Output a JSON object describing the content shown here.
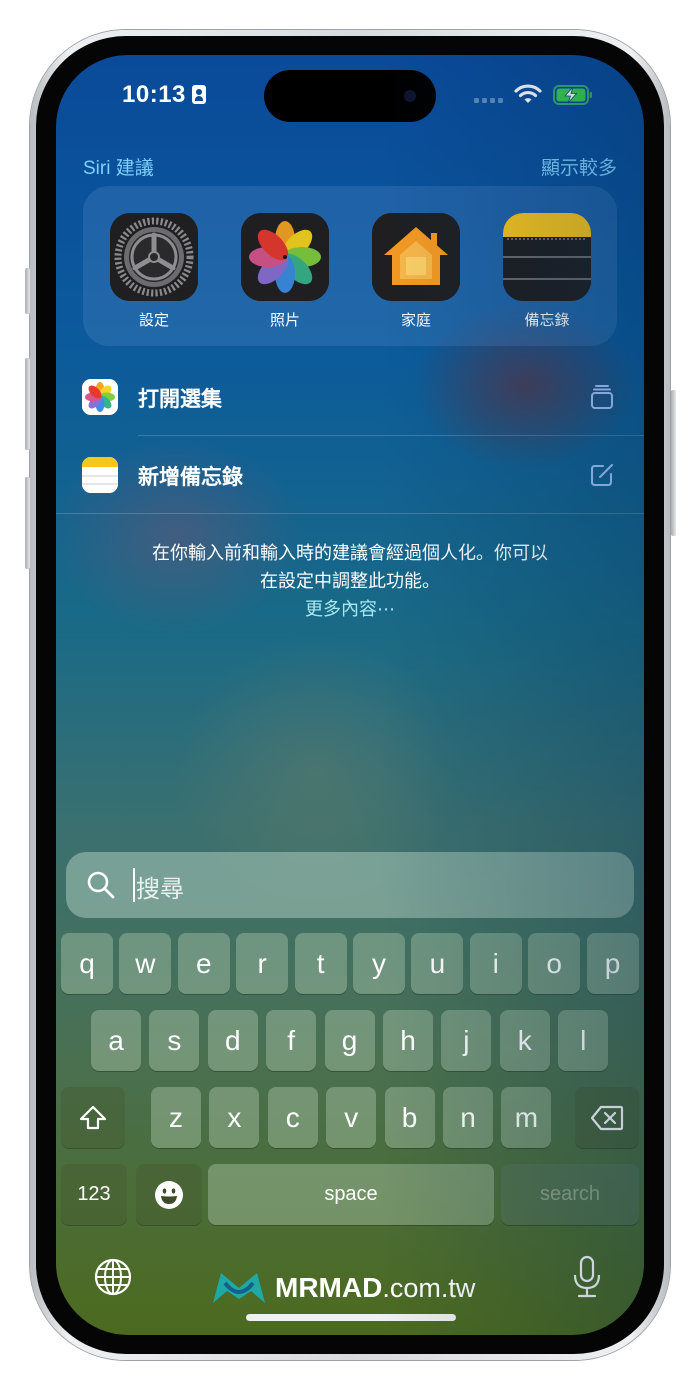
{
  "status_bar": {
    "time": "10:13",
    "icons": [
      "id-card-icon",
      "signal-icon",
      "wifi-icon",
      "battery-charging-icon"
    ]
  },
  "siri_suggestions": {
    "title": "Siri 建議",
    "show_more": "顯示較多",
    "apps": [
      {
        "label": "設定",
        "icon": "settings-icon"
      },
      {
        "label": "照片",
        "icon": "photos-icon"
      },
      {
        "label": "家庭",
        "icon": "home-icon"
      },
      {
        "label": "備忘錄",
        "icon": "notes-icon"
      }
    ]
  },
  "shortcuts": [
    {
      "label": "打開選集",
      "app_icon": "photos-icon",
      "action_icon": "stack-icon"
    },
    {
      "label": "新增備忘錄",
      "app_icon": "notes-icon",
      "action_icon": "compose-icon"
    }
  ],
  "notice": {
    "line1": "在你輸入前和輸入時的建議會經過個人化。你可以",
    "line2": "在設定中調整此功能。",
    "more": "更多內容⋯"
  },
  "search": {
    "placeholder": "搜尋",
    "value": ""
  },
  "keyboard": {
    "row1": [
      "q",
      "w",
      "e",
      "r",
      "t",
      "y",
      "u",
      "i",
      "o",
      "p"
    ],
    "row2": [
      "a",
      "s",
      "d",
      "f",
      "g",
      "h",
      "j",
      "k",
      "l"
    ],
    "row3": [
      "z",
      "x",
      "c",
      "v",
      "b",
      "n",
      "m"
    ],
    "numbers": "123",
    "space": "space",
    "search": "search"
  },
  "watermark": {
    "brand": "MRMAD",
    "domain": ".com.tw"
  }
}
